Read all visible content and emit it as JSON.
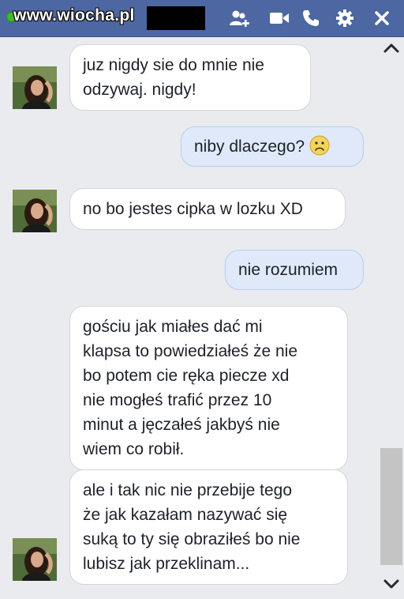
{
  "header": {
    "watermark": "www.wiocha.pl",
    "icons": [
      "add-friend-icon",
      "video-call-icon",
      "phone-icon",
      "gear-icon",
      "close-icon"
    ]
  },
  "messages": [
    {
      "id": 1,
      "direction": "incoming",
      "text": "juz nigdy sie do mnie nie\nodzywaj. nigdy!",
      "avatar": true
    },
    {
      "id": 2,
      "direction": "outgoing",
      "text": "niby dlaczego?",
      "emoji": "frown-emoji"
    },
    {
      "id": 3,
      "direction": "incoming",
      "text": "no bo jestes cipka w lozku XD",
      "avatar": true
    },
    {
      "id": 4,
      "direction": "outgoing",
      "text": "nie rozumiem"
    },
    {
      "id": 5,
      "direction": "incoming",
      "text": "gościu jak miałes dać mi\nklapsa to powiedziałeś że nie\nbo potem cie ręka piecze xd\nnie mogłeś trafić przez 10\nminut a jęczałeś jakbyś nie\nwiem co robił."
    },
    {
      "id": 6,
      "direction": "incoming",
      "text": "ale i tak nic nie przebije tego\nże jak kazałam nazywać się\nsuką to ty się obraziłeś bo nie\nlubisz jak przeklinam...",
      "avatar": true
    }
  ],
  "colors": {
    "header": "#4c67a1",
    "incoming_bubble": "#ffffff",
    "outgoing_bubble": "#dfe9fa",
    "background": "#eaebee"
  },
  "scrollbar": {
    "up": "chevron-up-icon",
    "down": "chevron-down-icon"
  }
}
